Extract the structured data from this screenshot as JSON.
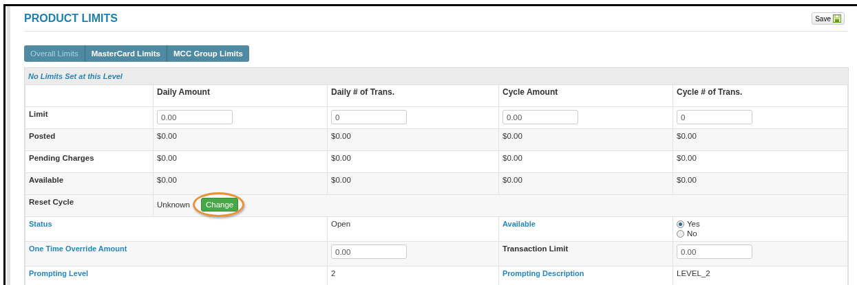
{
  "page": {
    "title": "PRODUCT LIMITS",
    "save_button": "Save"
  },
  "tabs": [
    {
      "label": "Overall Limits",
      "selected": true
    },
    {
      "label": "MasterCard Limits",
      "selected": false
    },
    {
      "label": "MCC Group Limits",
      "selected": false
    }
  ],
  "notice": "No Limits Set at this Level",
  "limits_table": {
    "columns": [
      "Daily Amount",
      "Daily # of Trans.",
      "Cycle Amount",
      "Cycle # of Trans."
    ],
    "rows": [
      {
        "label": "Limit",
        "kind": "input",
        "values": [
          "0.00",
          "0",
          "0.00",
          "0"
        ]
      },
      {
        "label": "Posted",
        "kind": "text",
        "values": [
          "$0.00",
          "$0.00",
          "$0.00",
          "$0.00"
        ]
      },
      {
        "label": "Pending Charges",
        "kind": "text",
        "values": [
          "$0.00",
          "$0.00",
          "$0.00",
          "$0.00"
        ]
      },
      {
        "label": "Available",
        "kind": "text",
        "values": [
          "$0.00",
          "$0.00",
          "$0.00",
          "$0.00"
        ]
      }
    ],
    "reset_cycle": {
      "label": "Reset Cycle",
      "value": "Unknown",
      "button": "Change",
      "highlighted": true
    }
  },
  "details": [
    {
      "label": "Status",
      "label_link": true,
      "value": {
        "kind": "text",
        "text": "Open"
      },
      "label_2": "Available",
      "label_2_link": true,
      "value_2": {
        "kind": "radios",
        "options": [
          {
            "label": "Yes",
            "selected": true
          },
          {
            "label": "No",
            "selected": false
          }
        ]
      }
    },
    {
      "label": "One Time Override Amount",
      "label_link": true,
      "value": {
        "kind": "input",
        "text": "0.00"
      },
      "label_2": "Transaction Limit",
      "label_2_link": false,
      "value_2": {
        "kind": "input",
        "text": "0.00"
      }
    },
    {
      "label": "Prompting Level",
      "label_link": true,
      "value": {
        "kind": "text",
        "text": "2"
      },
      "label_2": "Prompting Description",
      "label_2_link": true,
      "value_2": {
        "kind": "text",
        "text": "LEVEL_2"
      }
    }
  ]
}
